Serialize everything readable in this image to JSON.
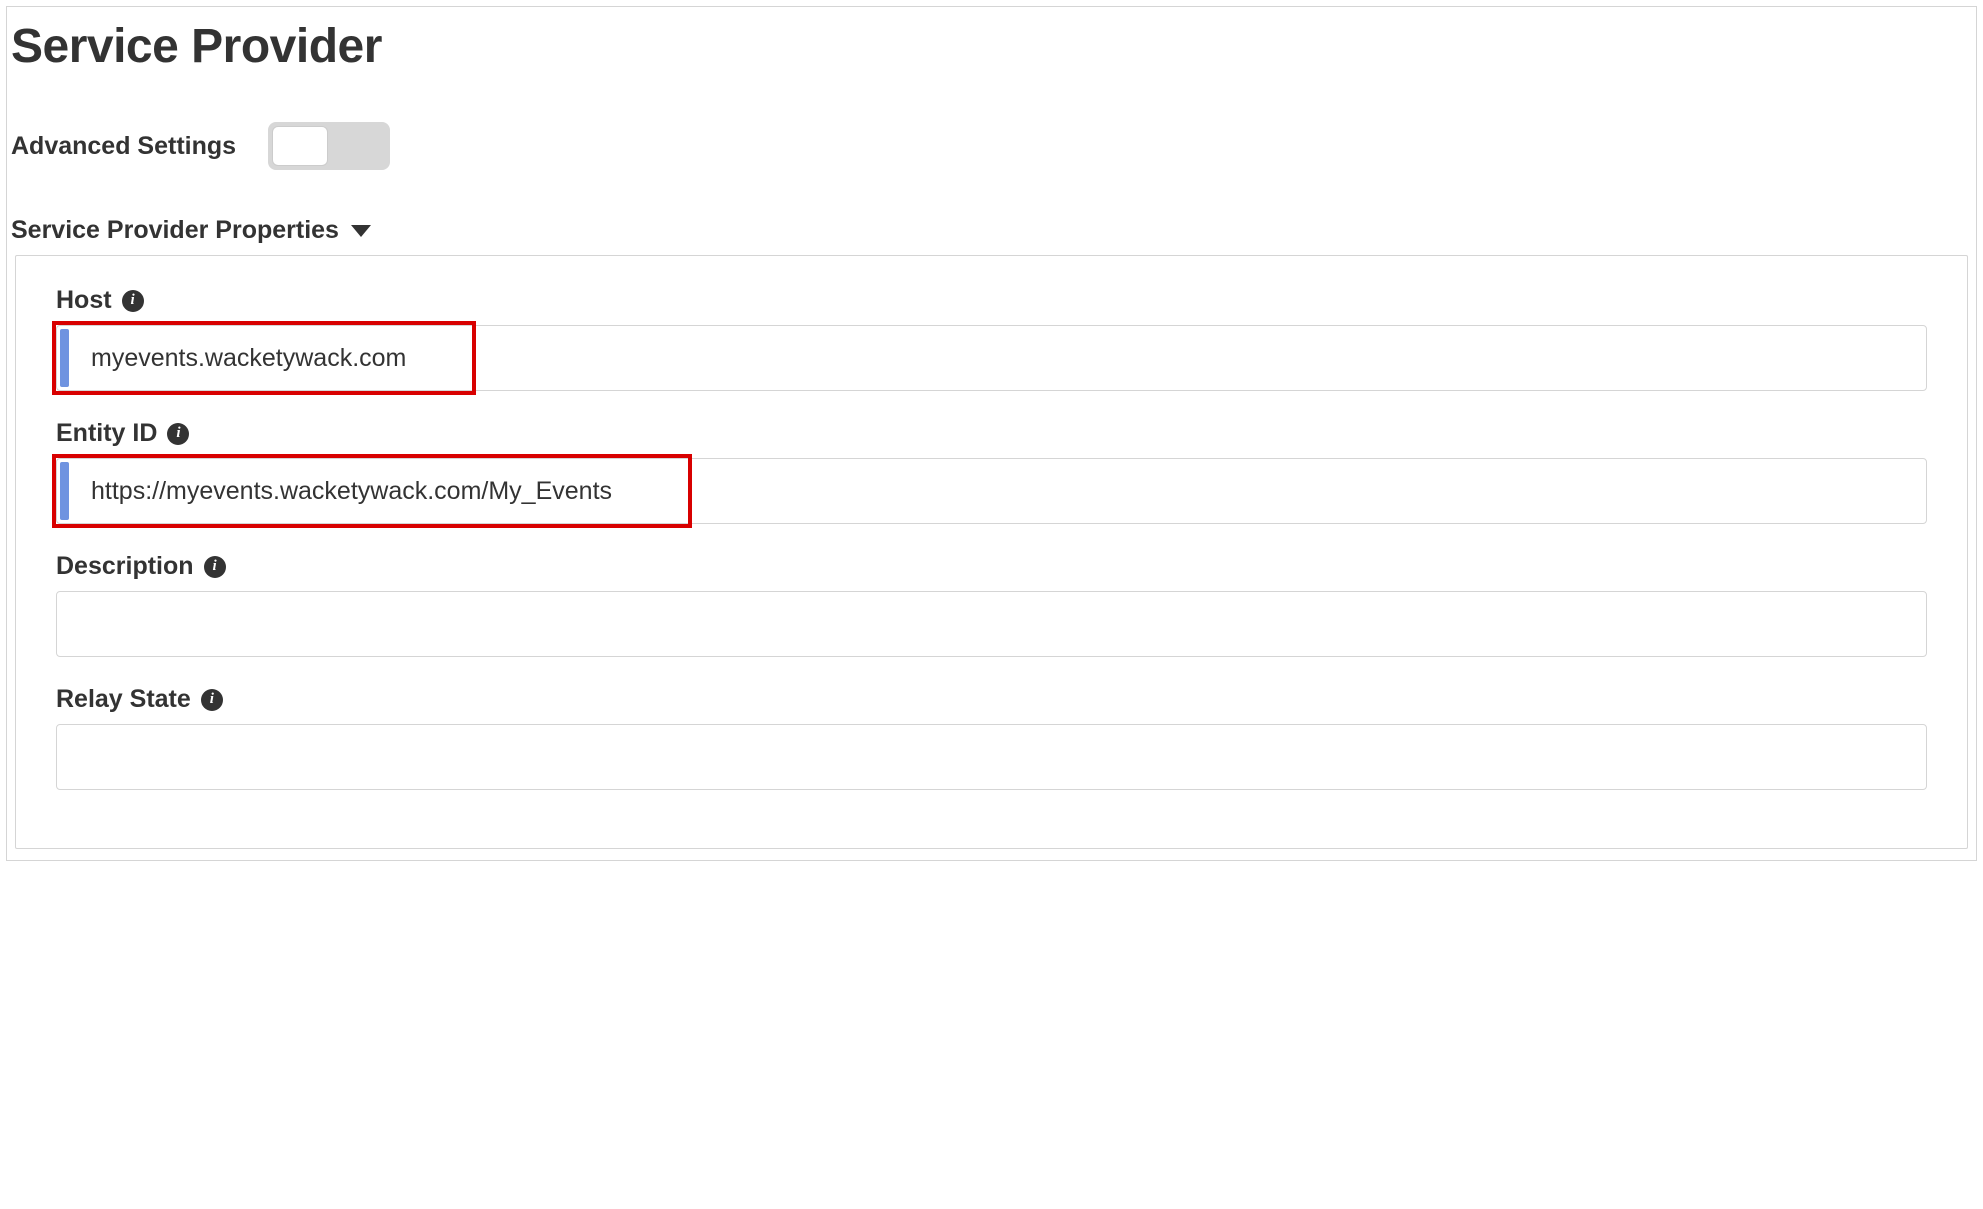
{
  "page": {
    "title": "Service Provider"
  },
  "advanced": {
    "label": "Advanced Settings",
    "toggle_state": "off"
  },
  "section": {
    "title": "Service Provider Properties"
  },
  "fields": {
    "host": {
      "label": "Host",
      "value": "myevents.wacketywack.com"
    },
    "entity_id": {
      "label": "Entity ID",
      "value": "https://myevents.wacketywack.com/My_Events"
    },
    "description": {
      "label": "Description",
      "value": ""
    },
    "relay_state": {
      "label": "Relay State",
      "value": ""
    }
  },
  "icons": {
    "info_glyph": "i"
  }
}
